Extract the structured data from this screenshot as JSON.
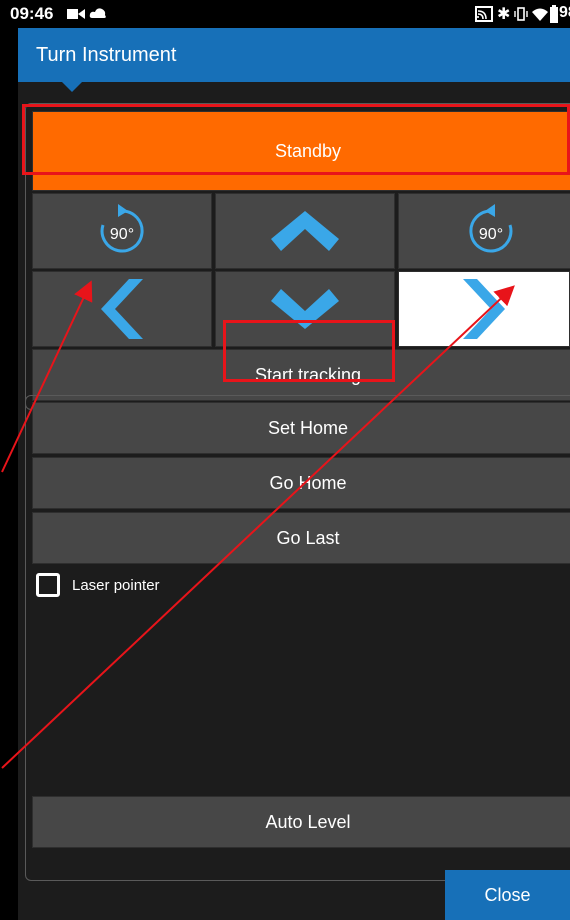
{
  "status_bar": {
    "time": "09:46",
    "battery_text": "98"
  },
  "dialog": {
    "title": "Turn Instrument"
  },
  "controls": {
    "standby_label": "Standby",
    "rotate_cw_label": "90°",
    "rotate_ccw_label": "90°",
    "start_tracking_label": "Start tracking"
  },
  "actions": {
    "set_home_label": "Set Home",
    "go_home_label": "Go Home",
    "go_last_label": "Go Last",
    "laser_pointer_label": "Laser pointer",
    "auto_level_label": "Auto Level"
  },
  "footer": {
    "close_label": "Close"
  },
  "colors": {
    "accent": "#1770b8",
    "standby": "#ff6a00",
    "annotation": "#e8141a",
    "arrow_icon": "#3aa7e8"
  }
}
